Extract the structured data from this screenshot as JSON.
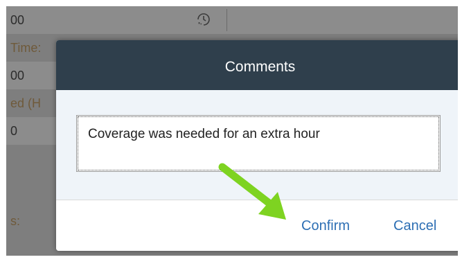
{
  "background_form": {
    "rows": [
      {
        "text": "00"
      },
      {
        "text": "Time:"
      },
      {
        "text": "00"
      },
      {
        "text": "ed (H"
      },
      {
        "text": "0"
      },
      {
        "text": "s:"
      }
    ]
  },
  "dialog": {
    "title": "Comments",
    "comment_value": "Coverage was needed for an extra hour",
    "confirm_label": "Confirm",
    "cancel_label": "Cancel"
  },
  "colors": {
    "header": "#2f3f4c",
    "body": "#eff4f9",
    "button_text": "#2d6fb4",
    "annotation_arrow": "#7ed321"
  },
  "icons": {
    "time_picker": "clock-history-icon",
    "annotation": "green-arrow-icon"
  }
}
